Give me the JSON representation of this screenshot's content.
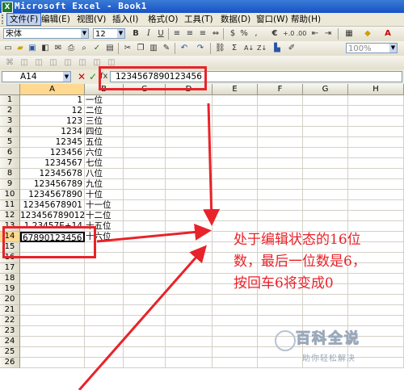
{
  "window": {
    "title": "Microsoft Excel - Book1",
    "app_icon": "excel-icon"
  },
  "menu": [
    "文件(F)",
    "编辑(E)",
    "视图(V)",
    "插入(I)",
    "格式(O)",
    "工具(T)",
    "数据(D)",
    "窗口(W)",
    "帮助(H)"
  ],
  "toolbar": {
    "font_name": "宋体",
    "font_size": "12",
    "bold": "B",
    "italic": "I",
    "underline": "U",
    "percent": "%",
    "comma": ",",
    "euro": "€",
    "zoom": "100%"
  },
  "formula_bar": {
    "name_box": "A14",
    "cancel": "✕",
    "enter": "✓",
    "fx": "fx",
    "content": "1234567890123456"
  },
  "columns": [
    "A",
    "B",
    "C",
    "D",
    "E",
    "F",
    "G",
    "H"
  ],
  "rows": [
    "1",
    "2",
    "3",
    "4",
    "5",
    "6",
    "7",
    "8",
    "9",
    "10",
    "11",
    "12",
    "13",
    "14",
    "15",
    "16",
    "17",
    "18",
    "19",
    "20",
    "21",
    "22",
    "23",
    "24",
    "25",
    "26"
  ],
  "cells": {
    "a": [
      "1",
      "12",
      "123",
      "1234",
      "12345",
      "123456",
      "1234567",
      "12345678",
      "123456789",
      "1234567890",
      "12345678901",
      "123456789012",
      "1.23457E+14",
      "67890123456"
    ],
    "b": [
      "一位",
      "二位",
      "三位",
      "四位",
      "五位",
      "六位",
      "七位",
      "八位",
      "九位",
      "十位",
      "十一位",
      "十二位",
      "十五位",
      "十六位"
    ]
  },
  "annotation": {
    "line1": "处于编辑状态的16位",
    "line2": "数，最后一位数是6，",
    "line3": "按回车6将变成0"
  },
  "watermark": {
    "big": "百科全说",
    "small": "助你轻松解决"
  },
  "colors": {
    "arrow": "#e8232a",
    "title_bar": "#1752c7",
    "chrome": "#ece9d8"
  }
}
